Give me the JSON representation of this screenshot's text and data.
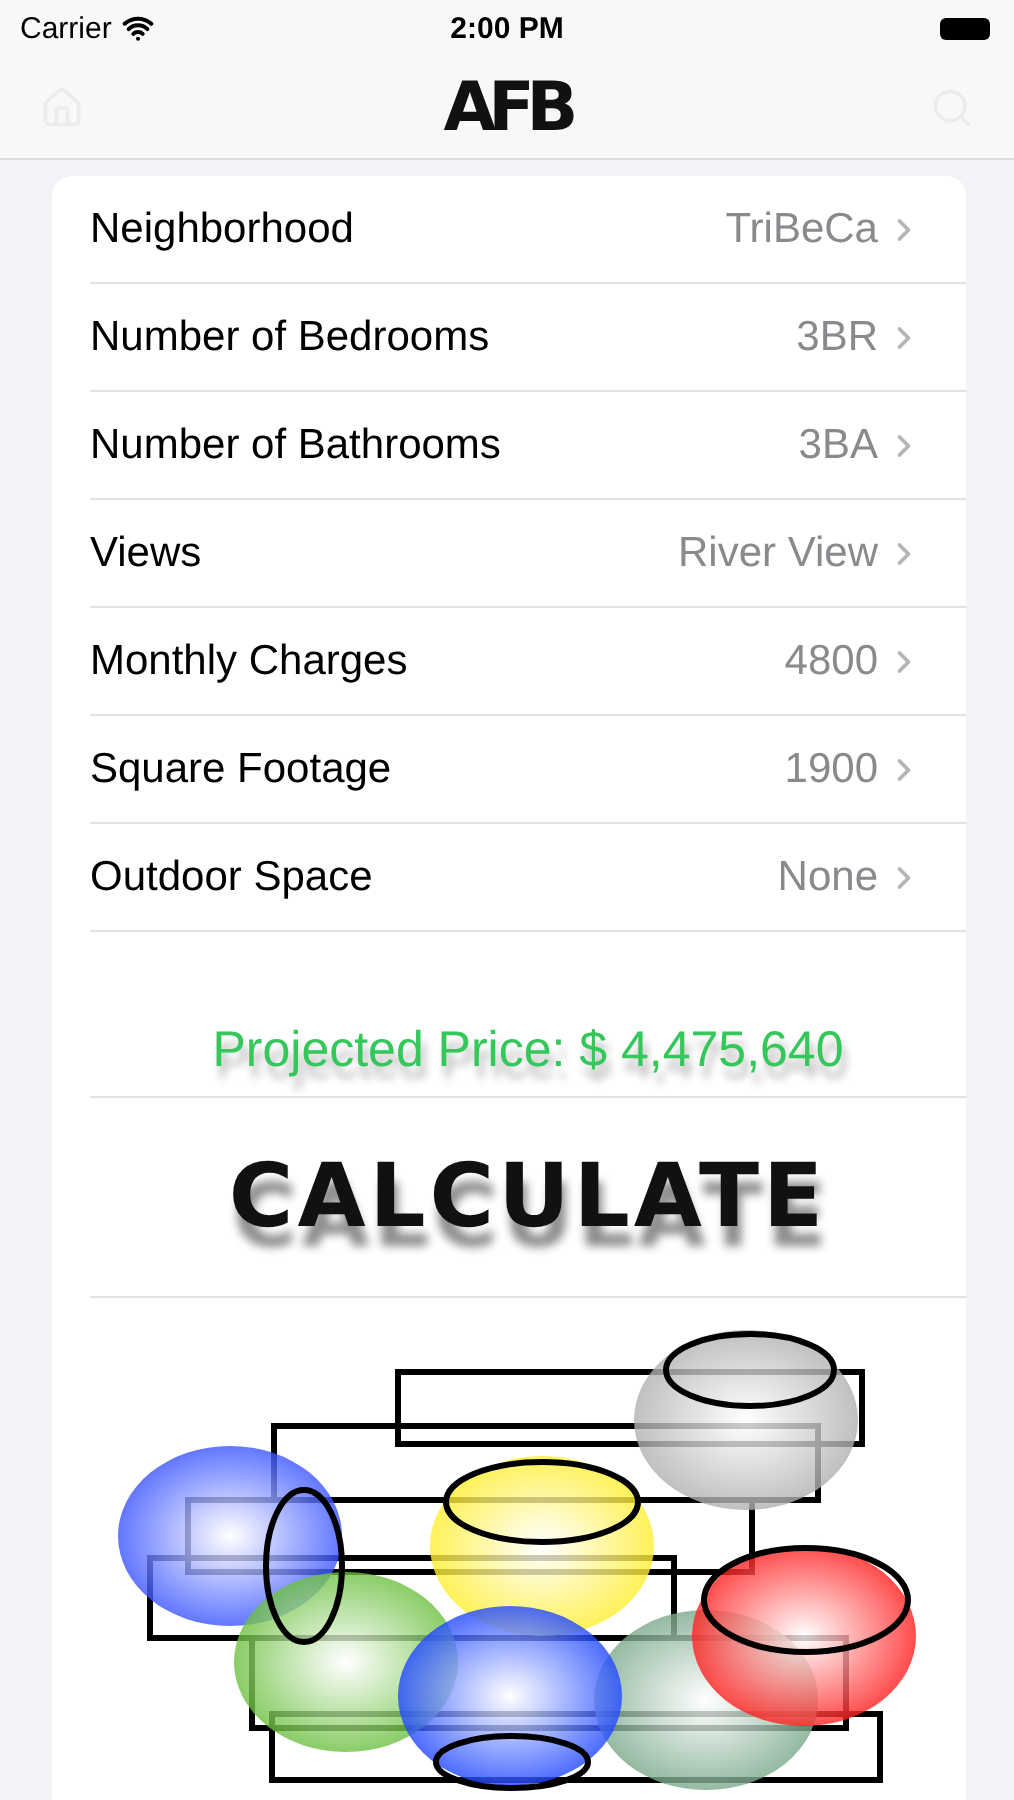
{
  "status_bar": {
    "carrier": "Carrier",
    "time": "2:00 PM"
  },
  "nav_bar": {
    "logo": "AFB"
  },
  "rows": [
    {
      "label": "Neighborhood",
      "value": "TriBeCa"
    },
    {
      "label": "Number of Bedrooms",
      "value": "3BR"
    },
    {
      "label": "Number of Bathrooms",
      "value": "3BA"
    },
    {
      "label": "Views",
      "value": "River View"
    },
    {
      "label": "Monthly Charges",
      "value": "4800"
    },
    {
      "label": "Square Footage",
      "value": "1900"
    },
    {
      "label": "Outdoor Space",
      "value": "None"
    }
  ],
  "result": {
    "text": "Projected Price: $ 4,475,640"
  },
  "calculate_button": {
    "label": "CALCULATE"
  }
}
